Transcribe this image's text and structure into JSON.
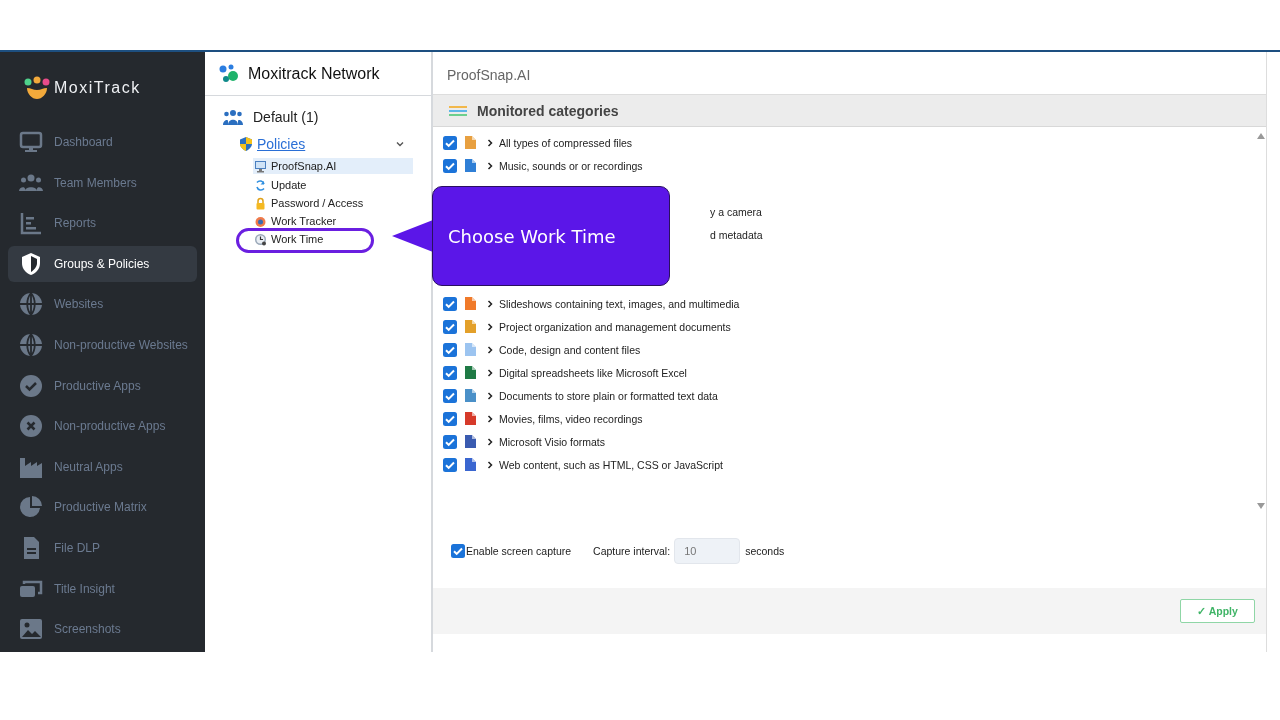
{
  "sidebar": {
    "logo": "MoxiTrack",
    "items": [
      {
        "label": "Dashboard",
        "selected": false
      },
      {
        "label": "Team Members",
        "selected": false
      },
      {
        "label": "Reports",
        "selected": false
      },
      {
        "label": "Groups & Policies",
        "selected": true
      },
      {
        "label": "Websites",
        "selected": false
      },
      {
        "label": "Non-productive Websites",
        "selected": false
      },
      {
        "label": "Productive Apps",
        "selected": false
      },
      {
        "label": "Non-productive Apps",
        "selected": false
      },
      {
        "label": "Neutral Apps",
        "selected": false
      },
      {
        "label": "Productive Matrix",
        "selected": false
      },
      {
        "label": "File DLP",
        "selected": false
      },
      {
        "label": "Title Insight",
        "selected": false
      },
      {
        "label": "Screenshots",
        "selected": false
      }
    ]
  },
  "tree": {
    "title": "Moxitrack Network",
    "group": "Default (1)",
    "policies": {
      "label": "Policies",
      "expanded": true
    },
    "items": [
      {
        "label": "ProofSnap.AI",
        "selected": true
      },
      {
        "label": "Update",
        "selected": false
      },
      {
        "label": "Password / Access",
        "selected": false
      },
      {
        "label": "Work Tracker",
        "selected": false
      },
      {
        "label": "Work Time",
        "selected": false
      }
    ]
  },
  "main": {
    "title": "ProofSnap.AI",
    "section": "Monitored categories",
    "rows": [
      {
        "kind": "row",
        "label": "All types of compressed files",
        "checked": true,
        "color": "#e8a040"
      },
      {
        "kind": "row",
        "label": "Music, sounds or or recordings",
        "checked": true,
        "color": "#2f7fd6"
      },
      {
        "kind": "covered"
      },
      {
        "kind": "covered",
        "label": "y a camera"
      },
      {
        "kind": "covered",
        "label": "d metadata"
      },
      {
        "kind": "covered"
      },
      {
        "kind": "covered"
      },
      {
        "kind": "row",
        "label": "Slideshows containing text, images, and multimedia",
        "checked": true,
        "color": "#f07a2a"
      },
      {
        "kind": "row",
        "label": "Project organization and management documents",
        "checked": true,
        "color": "#e3a02a"
      },
      {
        "kind": "row",
        "label": "Code, design and content files",
        "checked": true,
        "color": "#9cc4f0"
      },
      {
        "kind": "row",
        "label": "Digital spreadsheets like Microsoft Excel",
        "checked": true,
        "color": "#1f7a45"
      },
      {
        "kind": "row",
        "label": "Documents to store plain or formatted text data",
        "checked": true,
        "color": "#4a90c8"
      },
      {
        "kind": "row",
        "label": "Movies, films, video recordings",
        "checked": true,
        "color": "#d63a2a"
      },
      {
        "kind": "row",
        "label": "Microsoft Visio formats",
        "checked": true,
        "color": "#3a5bb0"
      },
      {
        "kind": "row",
        "label": "Web content, such as HTML, CSS or JavaScript",
        "checked": true,
        "color": "#3a66d0"
      }
    ],
    "capture": {
      "label": "Enable screen capture",
      "checked": true
    },
    "interval": {
      "label": "Capture interval:",
      "value": "10",
      "unit": "seconds"
    },
    "apply": "✓ Apply"
  },
  "callout": {
    "text": "Choose Work Time"
  }
}
